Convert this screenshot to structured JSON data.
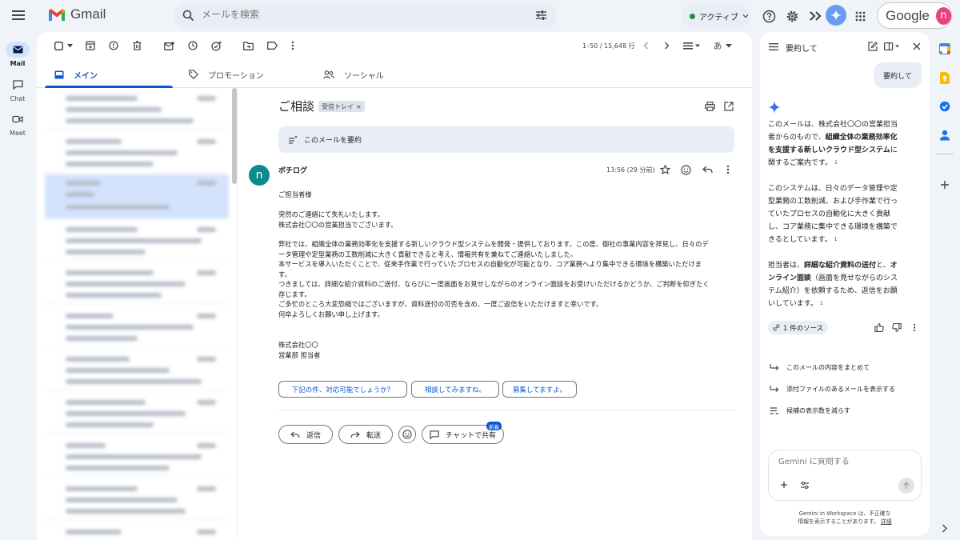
{
  "app": {
    "logo_text": "Gmail",
    "account_word": "Google",
    "avatar_letter": "n",
    "status_label": "アクティブ",
    "colors": {
      "accent": "#0b57d0",
      "brand_red": "#ea4335",
      "avatar_bg": "#e8437a",
      "active_green": "#1e8e3e"
    }
  },
  "search": {
    "placeholder": "メールを検索"
  },
  "rail": [
    {
      "label": "Mail",
      "icon": "mail-icon",
      "active": true
    },
    {
      "label": "Chat",
      "icon": "chat-icon",
      "active": false
    },
    {
      "label": "Meet",
      "icon": "video-icon",
      "active": false
    }
  ],
  "toolbar": {
    "pager": "1–50 / 15,648 行",
    "input_tool": "あ"
  },
  "tabs": [
    {
      "label": "メイン",
      "icon": "inbox-icon",
      "active": true
    },
    {
      "label": "プロモーション",
      "icon": "tag-icon",
      "active": false
    },
    {
      "label": "ソーシャル",
      "icon": "people-icon",
      "active": false
    }
  ],
  "email": {
    "subject": "ご相談",
    "label_chip": "受信トレイ",
    "summarize_label": "このメールを要約",
    "sender_initial": "n",
    "sender_name": "ボチログ",
    "timestamp": "13:56 (29 分前)",
    "body": [
      "ご担当者様",
      "突然のご連絡にて失礼いたします。",
      "株式会社〇〇の営業担当でございます。",
      "弊社では、組織全体の業務効率化を支援する新しいクラウド型システムを開発・提供しております。この度、御社の事業内容を拝見し、日々のデ",
      "ータ管理や定型業務の工数削減に大きく貢献できると考え、情報共有を兼ねてご連絡いたしました。",
      "本サービスを導入いただくことで、従来手作業で行っていたプロセスの自動化が可能となり、コア業務へより集中できる環境を構築いただけま",
      "す。",
      "つきましては、詳細な紹介資料のご送付、ならびに一度画面をお見せしながらのオンライン面談をお受けいただけるかどうか、ご判断を仰ぎたく",
      "存じます。",
      "ご多忙のところ大変恐縮ではございますが、資料送付の可否を含め、一度ご返信をいただけますと幸いです。",
      "何卒よろしくお願い申し上げます。",
      "株式会社〇〇",
      "営業部 担当者"
    ],
    "smart_replies": [
      "下記の件、対応可能でしょうか？",
      "相談してみますね。",
      "募集してますよ。"
    ],
    "actions": {
      "reply": "返信",
      "forward": "転送",
      "share_chat": "チャットで共有",
      "new_badge": "新着"
    }
  },
  "gemini": {
    "title": "要約して",
    "user_message": "要約して",
    "response": [
      {
        "parts": [
          {
            "t": "このメールは、株式会社〇〇の営業担当者からのもので、"
          },
          {
            "t": "組織全体の業務効率化を支援する新しいクラウド型システム",
            "b": true
          },
          {
            "t": "に関するご案内です。"
          }
        ],
        "cite": "1"
      },
      {
        "parts": [
          {
            "t": "このシステムは、日々のデータ管理や定型業務の工数削減、および手作業で行っていたプロセスの自動化に大きく貢献し、コア業務に集中できる環境を構築できるとしています。"
          }
        ],
        "cite": "1"
      },
      {
        "parts": [
          {
            "t": "担当者は、"
          },
          {
            "t": "詳細な紹介資料の送付",
            "b": true
          },
          {
            "t": "と、"
          },
          {
            "t": "オンライン面談",
            "b": true
          },
          {
            "t": "（画面を見せながらのシステム紹介）を依頼するため、返信をお願いしています。"
          }
        ],
        "cite": "1"
      }
    ],
    "source_chip": "1 件のソース",
    "suggestions": [
      {
        "label": "このメールの内容をまとめて",
        "icon": "arrow-turn-icon"
      },
      {
        "label": "添付ファイルのあるメールを表示する",
        "icon": "arrow-turn-icon"
      },
      {
        "label": "候補の表示数を減らす",
        "icon": "list-reduce-icon"
      }
    ],
    "input_placeholder": "Gemini に質問する",
    "disclaimer_1": "Gemini in Workspace は、不正確な",
    "disclaimer_2": "情報を表示することがあります。",
    "disclaimer_link": "詳細"
  }
}
